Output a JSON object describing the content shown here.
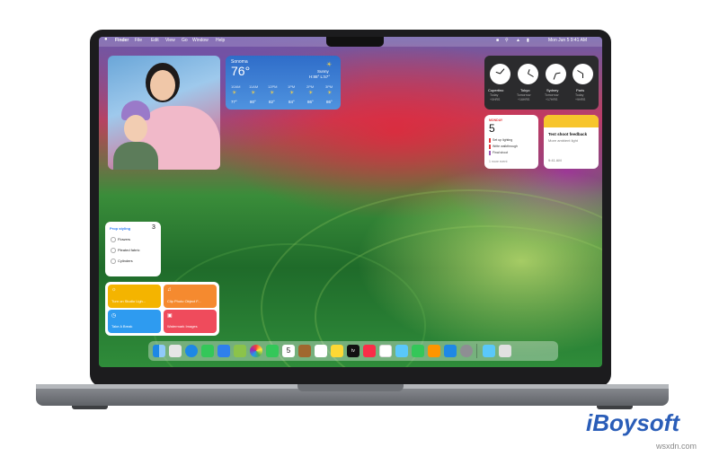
{
  "menubar": {
    "items": [
      "Finder",
      "File",
      "Edit",
      "View",
      "Go",
      "Window",
      "Help"
    ],
    "clock": "Mon Jun 5  9:41 AM"
  },
  "weather": {
    "city": "Sonoma",
    "temp": "76°",
    "condition": "Sunny",
    "hilo": "H:88° L:57°",
    "hours": [
      "10AM",
      "11AM",
      "12PM",
      "1PM",
      "2PM",
      "3PM"
    ],
    "temps": [
      "77°",
      "80°",
      "82°",
      "84°",
      "86°",
      "86°"
    ]
  },
  "world_clock": {
    "cities": [
      "Cupertino",
      "Tokyo",
      "Sydney",
      "Paris"
    ],
    "days": [
      "Today",
      "Tomorrow",
      "Tomorrow",
      "Today"
    ],
    "offsets": [
      "+0HRS",
      "+16HRS",
      "+17HRS",
      "+9HRS"
    ]
  },
  "calendar": {
    "weekday": "MONDAY",
    "day": "5",
    "events": [
      "Set up lighting",
      "Write walkthrough",
      "Final shoot"
    ],
    "more": "1 more event"
  },
  "notes": {
    "title": "Test shoot feedback",
    "subtitle": "More ambient light",
    "time": "9:41 AM"
  },
  "reminders": {
    "title": "Prop styling",
    "count": "3",
    "items": [
      "Flowers",
      "Pleated fabric",
      "Cylinders"
    ]
  },
  "shortcuts": [
    "Turn on Studio Ligh...",
    "Clip Photo Object F...",
    "Take A Break",
    "Watermark Images"
  ],
  "dock": {
    "calendar_day": "5",
    "tv_label": "tv"
  },
  "brand": {
    "logo": "iBoysoft",
    "watermark": "wsxdn.com"
  },
  "colors": {
    "weather_bg": "#3d7fd6",
    "shortcut_yellow": "#f4b400",
    "shortcut_orange": "#f58a2f",
    "shortcut_blue": "#2e9bf0",
    "shortcut_red": "#ef4b5c",
    "logo_blue": "#2a5db8"
  }
}
